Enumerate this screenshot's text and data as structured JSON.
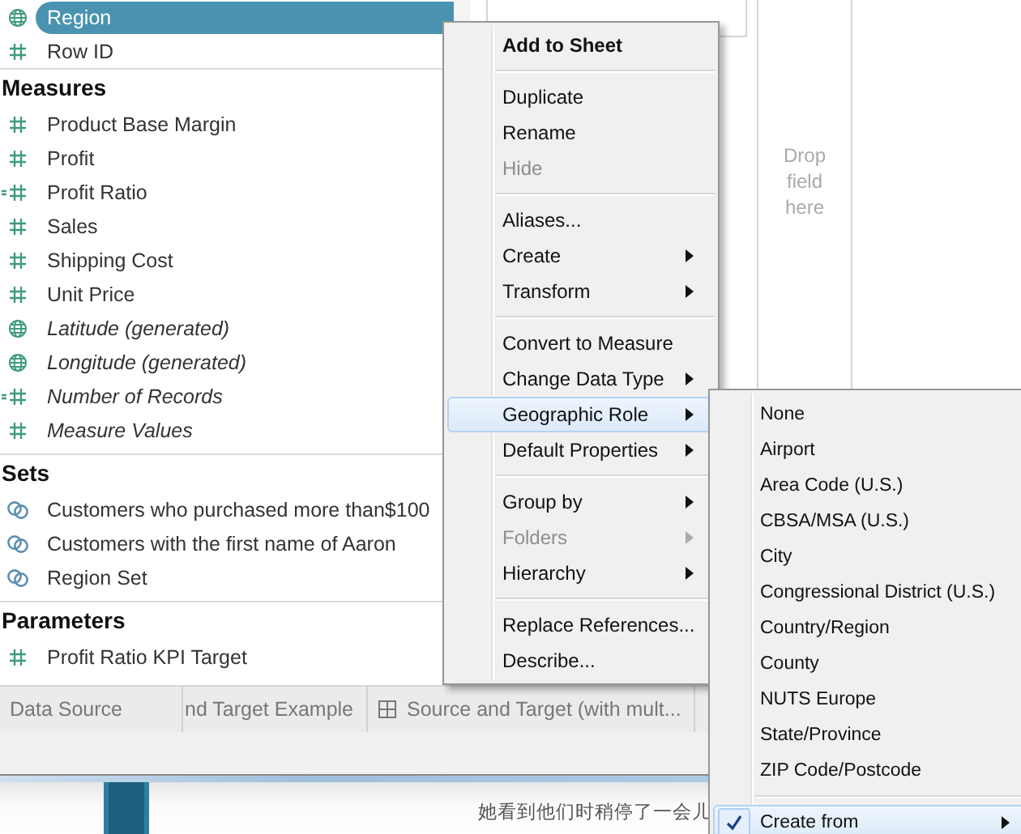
{
  "data_pane": {
    "fields": [
      {
        "label": "Region",
        "kind": "geo",
        "italic": false,
        "selected": true
      },
      {
        "label": "Row ID",
        "kind": "number",
        "italic": false,
        "selected": false
      }
    ],
    "sections": [
      {
        "title": "Measures",
        "fields": [
          {
            "label": "Product Base Margin",
            "kind": "number",
            "italic": false,
            "selected": false
          },
          {
            "label": "Profit",
            "kind": "number",
            "italic": false,
            "selected": false
          },
          {
            "label": "Profit Ratio",
            "kind": "calc",
            "italic": false,
            "selected": false
          },
          {
            "label": "Sales",
            "kind": "number",
            "italic": false,
            "selected": false
          },
          {
            "label": "Shipping Cost",
            "kind": "number",
            "italic": false,
            "selected": false
          },
          {
            "label": "Unit Price",
            "kind": "number",
            "italic": false,
            "selected": false
          },
          {
            "label": "Latitude (generated)",
            "kind": "geo",
            "italic": true,
            "selected": false
          },
          {
            "label": "Longitude (generated)",
            "kind": "geo",
            "italic": true,
            "selected": false
          },
          {
            "label": "Number of Records",
            "kind": "calc",
            "italic": true,
            "selected": false
          },
          {
            "label": "Measure Values",
            "kind": "number",
            "italic": true,
            "selected": false
          }
        ]
      },
      {
        "title": "Sets",
        "fields": [
          {
            "label": "Customers who purchased more than$100",
            "kind": "set",
            "italic": false,
            "selected": false
          },
          {
            "label": "Customers with the first name of Aaron",
            "kind": "set",
            "italic": false,
            "selected": false
          },
          {
            "label": "Region Set",
            "kind": "set",
            "italic": false,
            "selected": false
          }
        ]
      },
      {
        "title": "Parameters",
        "fields": [
          {
            "label": "Profit Ratio KPI Target",
            "kind": "number",
            "italic": false,
            "selected": false
          }
        ]
      }
    ]
  },
  "shelf": {
    "hint": "Drop field here"
  },
  "context_menu": {
    "groups": [
      {
        "items": [
          {
            "label": "Add to Sheet",
            "bold": true,
            "disabled": false,
            "submenu": false,
            "selected": false
          }
        ]
      },
      {
        "items": [
          {
            "label": "Duplicate",
            "bold": false,
            "disabled": false,
            "submenu": false,
            "selected": false
          },
          {
            "label": "Rename",
            "bold": false,
            "disabled": false,
            "submenu": false,
            "selected": false
          },
          {
            "label": "Hide",
            "bold": false,
            "disabled": true,
            "submenu": false,
            "selected": false
          }
        ]
      },
      {
        "items": [
          {
            "label": "Aliases...",
            "bold": false,
            "disabled": false,
            "submenu": false,
            "selected": false
          },
          {
            "label": "Create",
            "bold": false,
            "disabled": false,
            "submenu": true,
            "selected": false
          },
          {
            "label": "Transform",
            "bold": false,
            "disabled": false,
            "submenu": true,
            "selected": false
          }
        ]
      },
      {
        "items": [
          {
            "label": "Convert to Measure",
            "bold": false,
            "disabled": false,
            "submenu": false,
            "selected": false
          },
          {
            "label": "Change Data Type",
            "bold": false,
            "disabled": false,
            "submenu": true,
            "selected": false
          },
          {
            "label": "Geographic Role",
            "bold": false,
            "disabled": false,
            "submenu": true,
            "selected": true
          },
          {
            "label": "Default Properties",
            "bold": false,
            "disabled": false,
            "submenu": true,
            "selected": false
          }
        ]
      },
      {
        "items": [
          {
            "label": "Group by",
            "bold": false,
            "disabled": false,
            "submenu": true,
            "selected": false
          },
          {
            "label": "Folders",
            "bold": false,
            "disabled": true,
            "submenu": true,
            "selected": false
          },
          {
            "label": "Hierarchy",
            "bold": false,
            "disabled": false,
            "submenu": true,
            "selected": false
          }
        ]
      },
      {
        "items": [
          {
            "label": "Replace References...",
            "bold": false,
            "disabled": false,
            "submenu": false,
            "selected": false
          },
          {
            "label": "Describe...",
            "bold": false,
            "disabled": false,
            "submenu": false,
            "selected": false
          }
        ]
      }
    ]
  },
  "submenu": {
    "groups": [
      {
        "items": [
          {
            "label": "None",
            "checked": false,
            "submenu": false,
            "selected": false
          },
          {
            "label": "Airport",
            "checked": false,
            "submenu": false,
            "selected": false
          },
          {
            "label": "Area Code (U.S.)",
            "checked": false,
            "submenu": false,
            "selected": false
          },
          {
            "label": "CBSA/MSA (U.S.)",
            "checked": false,
            "submenu": false,
            "selected": false
          },
          {
            "label": "City",
            "checked": false,
            "submenu": false,
            "selected": false
          },
          {
            "label": "Congressional District (U.S.)",
            "checked": false,
            "submenu": false,
            "selected": false
          },
          {
            "label": "Country/Region",
            "checked": false,
            "submenu": false,
            "selected": false
          },
          {
            "label": "County",
            "checked": false,
            "submenu": false,
            "selected": false
          },
          {
            "label": "NUTS Europe",
            "checked": false,
            "submenu": false,
            "selected": false
          },
          {
            "label": "State/Province",
            "checked": false,
            "submenu": false,
            "selected": false
          },
          {
            "label": "ZIP Code/Postcode",
            "checked": false,
            "submenu": false,
            "selected": false
          }
        ]
      },
      {
        "items": [
          {
            "label": "Create from",
            "checked": true,
            "submenu": true,
            "selected": true
          }
        ]
      }
    ]
  },
  "sheet_tabs": [
    {
      "label": "Data Source",
      "kind": "plain"
    },
    {
      "label": "nd Target Example",
      "kind": "plain"
    },
    {
      "label": "Source and Target (with mult...",
      "kind": "grid"
    }
  ],
  "background_page": {
    "text": "她看到他们时稍停了一会儿"
  }
}
